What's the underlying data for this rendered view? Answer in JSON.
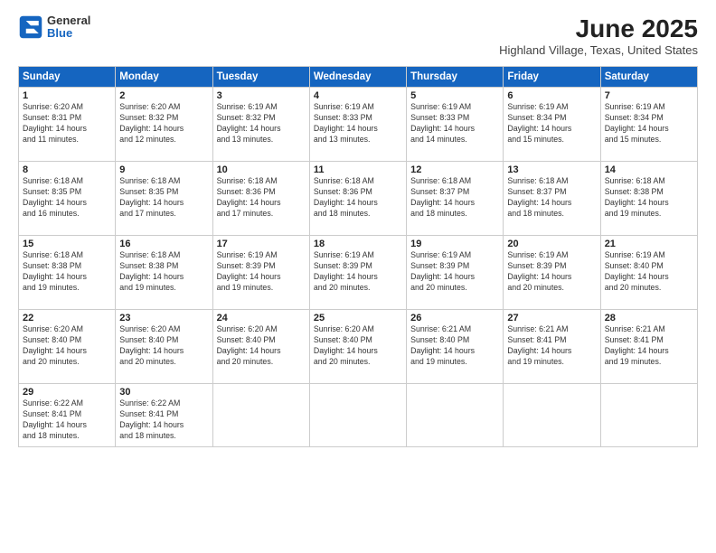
{
  "header": {
    "logo_general": "General",
    "logo_blue": "Blue",
    "month_year": "June 2025",
    "location": "Highland Village, Texas, United States"
  },
  "days_of_week": [
    "Sunday",
    "Monday",
    "Tuesday",
    "Wednesday",
    "Thursday",
    "Friday",
    "Saturday"
  ],
  "weeks": [
    [
      {
        "day": "1",
        "text": "Sunrise: 6:20 AM\nSunset: 8:31 PM\nDaylight: 14 hours\nand 11 minutes."
      },
      {
        "day": "2",
        "text": "Sunrise: 6:20 AM\nSunset: 8:32 PM\nDaylight: 14 hours\nand 12 minutes."
      },
      {
        "day": "3",
        "text": "Sunrise: 6:19 AM\nSunset: 8:32 PM\nDaylight: 14 hours\nand 13 minutes."
      },
      {
        "day": "4",
        "text": "Sunrise: 6:19 AM\nSunset: 8:33 PM\nDaylight: 14 hours\nand 13 minutes."
      },
      {
        "day": "5",
        "text": "Sunrise: 6:19 AM\nSunset: 8:33 PM\nDaylight: 14 hours\nand 14 minutes."
      },
      {
        "day": "6",
        "text": "Sunrise: 6:19 AM\nSunset: 8:34 PM\nDaylight: 14 hours\nand 15 minutes."
      },
      {
        "day": "7",
        "text": "Sunrise: 6:19 AM\nSunset: 8:34 PM\nDaylight: 14 hours\nand 15 minutes."
      }
    ],
    [
      {
        "day": "8",
        "text": "Sunrise: 6:18 AM\nSunset: 8:35 PM\nDaylight: 14 hours\nand 16 minutes."
      },
      {
        "day": "9",
        "text": "Sunrise: 6:18 AM\nSunset: 8:35 PM\nDaylight: 14 hours\nand 17 minutes."
      },
      {
        "day": "10",
        "text": "Sunrise: 6:18 AM\nSunset: 8:36 PM\nDaylight: 14 hours\nand 17 minutes."
      },
      {
        "day": "11",
        "text": "Sunrise: 6:18 AM\nSunset: 8:36 PM\nDaylight: 14 hours\nand 18 minutes."
      },
      {
        "day": "12",
        "text": "Sunrise: 6:18 AM\nSunset: 8:37 PM\nDaylight: 14 hours\nand 18 minutes."
      },
      {
        "day": "13",
        "text": "Sunrise: 6:18 AM\nSunset: 8:37 PM\nDaylight: 14 hours\nand 18 minutes."
      },
      {
        "day": "14",
        "text": "Sunrise: 6:18 AM\nSunset: 8:38 PM\nDaylight: 14 hours\nand 19 minutes."
      }
    ],
    [
      {
        "day": "15",
        "text": "Sunrise: 6:18 AM\nSunset: 8:38 PM\nDaylight: 14 hours\nand 19 minutes."
      },
      {
        "day": "16",
        "text": "Sunrise: 6:18 AM\nSunset: 8:38 PM\nDaylight: 14 hours\nand 19 minutes."
      },
      {
        "day": "17",
        "text": "Sunrise: 6:19 AM\nSunset: 8:39 PM\nDaylight: 14 hours\nand 19 minutes."
      },
      {
        "day": "18",
        "text": "Sunrise: 6:19 AM\nSunset: 8:39 PM\nDaylight: 14 hours\nand 20 minutes."
      },
      {
        "day": "19",
        "text": "Sunrise: 6:19 AM\nSunset: 8:39 PM\nDaylight: 14 hours\nand 20 minutes."
      },
      {
        "day": "20",
        "text": "Sunrise: 6:19 AM\nSunset: 8:39 PM\nDaylight: 14 hours\nand 20 minutes."
      },
      {
        "day": "21",
        "text": "Sunrise: 6:19 AM\nSunset: 8:40 PM\nDaylight: 14 hours\nand 20 minutes."
      }
    ],
    [
      {
        "day": "22",
        "text": "Sunrise: 6:20 AM\nSunset: 8:40 PM\nDaylight: 14 hours\nand 20 minutes."
      },
      {
        "day": "23",
        "text": "Sunrise: 6:20 AM\nSunset: 8:40 PM\nDaylight: 14 hours\nand 20 minutes."
      },
      {
        "day": "24",
        "text": "Sunrise: 6:20 AM\nSunset: 8:40 PM\nDaylight: 14 hours\nand 20 minutes."
      },
      {
        "day": "25",
        "text": "Sunrise: 6:20 AM\nSunset: 8:40 PM\nDaylight: 14 hours\nand 20 minutes."
      },
      {
        "day": "26",
        "text": "Sunrise: 6:21 AM\nSunset: 8:40 PM\nDaylight: 14 hours\nand 19 minutes."
      },
      {
        "day": "27",
        "text": "Sunrise: 6:21 AM\nSunset: 8:41 PM\nDaylight: 14 hours\nand 19 minutes."
      },
      {
        "day": "28",
        "text": "Sunrise: 6:21 AM\nSunset: 8:41 PM\nDaylight: 14 hours\nand 19 minutes."
      }
    ],
    [
      {
        "day": "29",
        "text": "Sunrise: 6:22 AM\nSunset: 8:41 PM\nDaylight: 14 hours\nand 18 minutes."
      },
      {
        "day": "30",
        "text": "Sunrise: 6:22 AM\nSunset: 8:41 PM\nDaylight: 14 hours\nand 18 minutes."
      },
      {
        "day": "",
        "text": "",
        "empty": true
      },
      {
        "day": "",
        "text": "",
        "empty": true
      },
      {
        "day": "",
        "text": "",
        "empty": true
      },
      {
        "day": "",
        "text": "",
        "empty": true
      },
      {
        "day": "",
        "text": "",
        "empty": true
      }
    ]
  ]
}
